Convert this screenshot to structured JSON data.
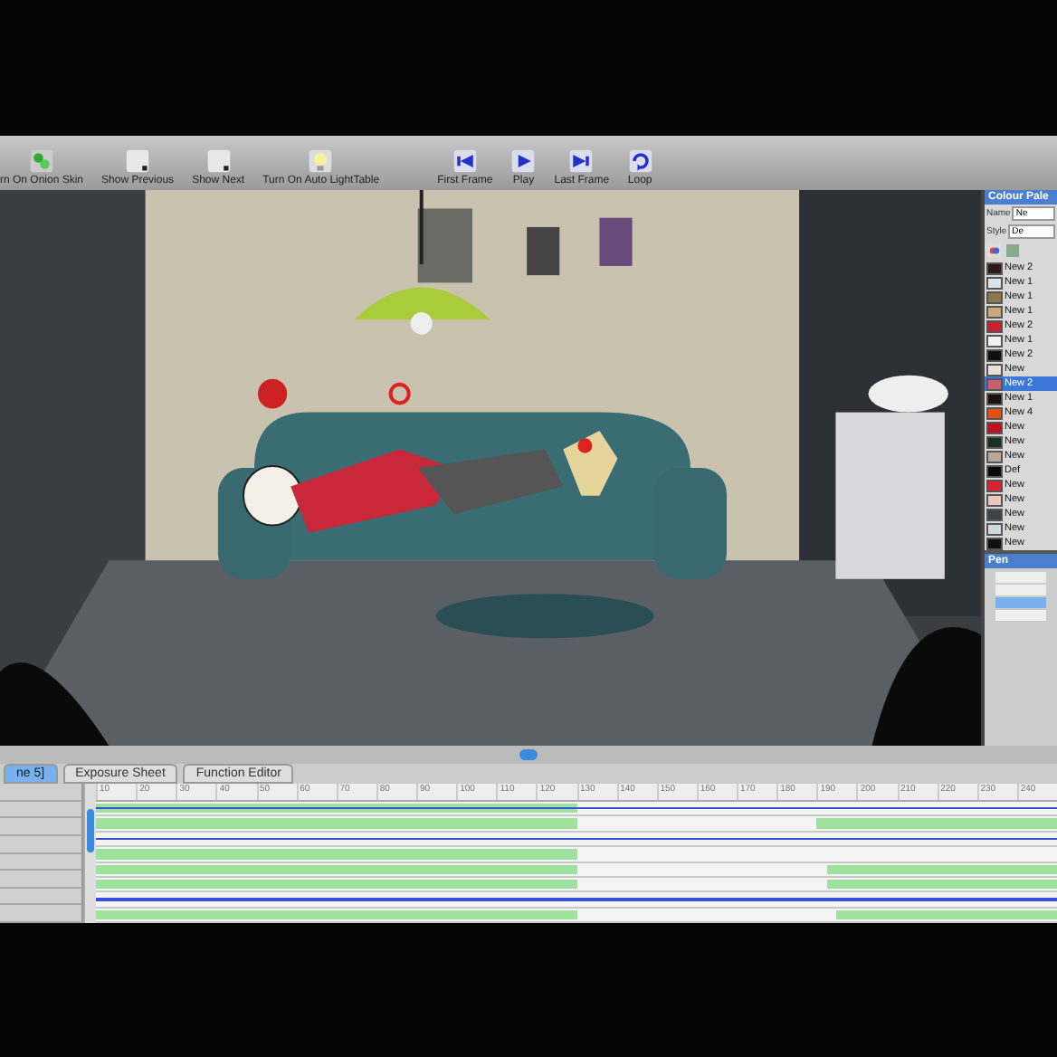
{
  "toolbar": {
    "buttons": [
      {
        "kind": "onion",
        "label": "rn On Onion Skin"
      },
      {
        "kind": "previous",
        "label": "Show Previous"
      },
      {
        "kind": "next",
        "label": "Show Next"
      },
      {
        "kind": "lightbulb",
        "label": "Turn On Auto LightTable"
      },
      {
        "kind": "first",
        "label": "First Frame"
      },
      {
        "kind": "play",
        "label": "Play"
      },
      {
        "kind": "last",
        "label": "Last Frame"
      },
      {
        "kind": "loop",
        "label": "Loop"
      }
    ]
  },
  "colour_palette": {
    "title": "Colour Pale",
    "name_label": "Name",
    "name_value": "Ne",
    "style_label": "Style",
    "style_value": "De",
    "swatches": [
      {
        "name": "New 2",
        "color": "#2a1a1a",
        "selected": false
      },
      {
        "name": "New 1",
        "color": "#d8e4ec",
        "selected": false
      },
      {
        "name": "New 1",
        "color": "#8a7a4a",
        "selected": false
      },
      {
        "name": "New 1",
        "color": "#c8a878",
        "selected": false
      },
      {
        "name": "New 2",
        "color": "#c82030",
        "selected": false
      },
      {
        "name": "New 1",
        "color": "#f0f0f0",
        "selected": false
      },
      {
        "name": "New 2",
        "color": "#101010",
        "selected": false
      },
      {
        "name": "New",
        "color": "#e8e0d8",
        "selected": false
      },
      {
        "name": "New 2",
        "color": "#c86070",
        "selected": true
      },
      {
        "name": "New 1",
        "color": "#1a1010",
        "selected": false
      },
      {
        "name": "New 4",
        "color": "#e05010",
        "selected": false
      },
      {
        "name": "New",
        "color": "#c01020",
        "selected": false
      },
      {
        "name": "New",
        "color": "#183020",
        "selected": false
      },
      {
        "name": "New",
        "color": "#b8a898",
        "selected": false
      },
      {
        "name": "Def",
        "color": "#080808",
        "selected": false
      },
      {
        "name": "New",
        "color": "#e02030",
        "selected": false
      },
      {
        "name": "New",
        "color": "#e8c8c0",
        "selected": false
      },
      {
        "name": "New",
        "color": "#404048",
        "selected": false
      },
      {
        "name": "New",
        "color": "#d0d8e0",
        "selected": false
      },
      {
        "name": "New",
        "color": "#101010",
        "selected": false
      }
    ]
  },
  "pen_panel": {
    "title": "Pen",
    "rows": [
      {
        "selected": false
      },
      {
        "selected": false
      },
      {
        "selected": true
      },
      {
        "selected": false
      }
    ]
  },
  "timeline": {
    "tabs": [
      {
        "label": "ne 5]",
        "selected": true
      },
      {
        "label": "Exposure Sheet",
        "selected": false
      },
      {
        "label": "Function Editor",
        "selected": false
      }
    ],
    "ruler": [
      "10",
      "20",
      "30",
      "40",
      "50",
      "60",
      "70",
      "80",
      "90",
      "100",
      "110",
      "120",
      "130",
      "140",
      "150",
      "160",
      "170",
      "180",
      "190",
      "200",
      "210",
      "220",
      "230",
      "240"
    ]
  }
}
